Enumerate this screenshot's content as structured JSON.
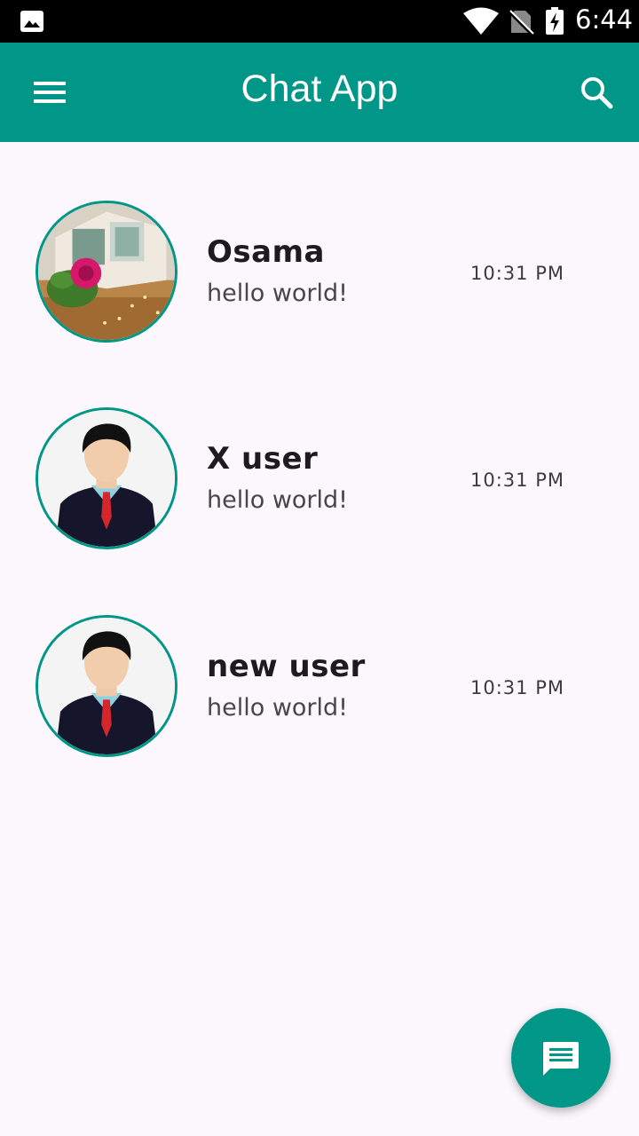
{
  "status_bar": {
    "time": "6:44",
    "icons": [
      "gallery-notification-icon",
      "wifi-icon",
      "no-sim-icon",
      "battery-charging-icon"
    ]
  },
  "app_bar": {
    "title": "Chat App",
    "menu_icon": "hamburger-menu-icon",
    "search_icon": "search-icon",
    "background": "#009688"
  },
  "chats": [
    {
      "name": "Osama",
      "last_message": "hello world!",
      "time": "10:31 PM",
      "avatar": "photo-flowers-book-avatar"
    },
    {
      "name": "X user",
      "last_message": "hello world!",
      "time": "10:31 PM",
      "avatar": "default-businessman-avatar"
    },
    {
      "name": "new user",
      "last_message": "hello world!",
      "time": "10:31 PM",
      "avatar": "default-businessman-avatar"
    }
  ],
  "fab": {
    "icon": "chat-message-icon",
    "color": "#009688"
  },
  "colors": {
    "accent": "#009688",
    "background": "#fcf6fd"
  }
}
